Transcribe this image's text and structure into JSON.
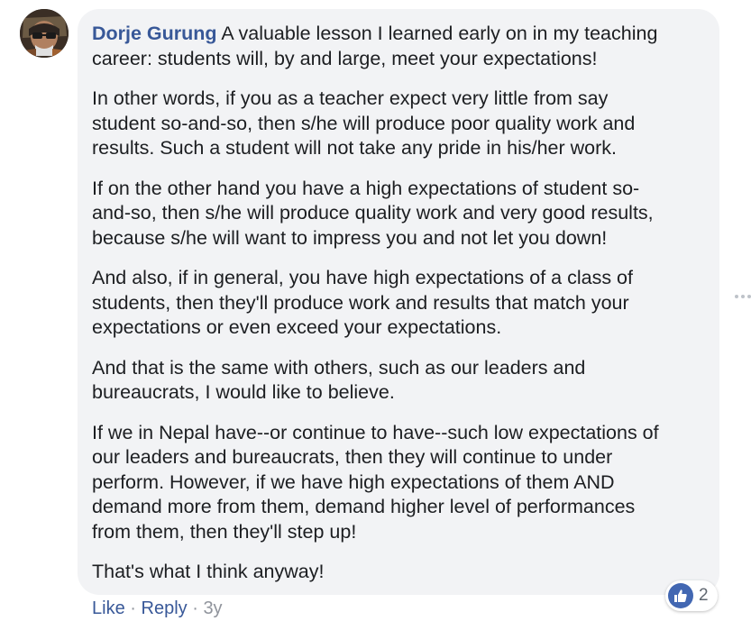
{
  "comment": {
    "author": "Dorje Gurung",
    "paragraphs": [
      "A valuable lesson I learned early on in my teaching\ncareer: students will, by and large, meet your expectations!",
      "In other words, if you as a teacher expect very little from say\nstudent so-and-so, then s/he will produce poor quality work and\nresults. Such a student will not take any pride in his/her work.",
      "If on the other hand you have a high expectations of student so-\nand-so, then s/he will produce quality work and very good results,\nbecause s/he will want to impress you and not let you down!",
      "And also, if in general, you have high expectations of a class of\nstudents, then they'll produce work and results that match your\nexpectations or even exceed your expectations.",
      "And that is the same with others, such as our leaders and\nbureaucrats, I would like to believe.",
      "If we in Nepal have--or continue to have--such low expectations of\nour leaders and bureaucrats, then they will continue to under\nperform. However, if we have high expectations of them AND\ndemand more from them, demand higher level of performances\nfrom them, then they'll step up!",
      "That's what I think anyway!"
    ]
  },
  "reactions": {
    "icon": "thumbs-up-icon",
    "count": "2",
    "color": "#4267b2"
  },
  "actions": {
    "like": "Like",
    "separator": "·",
    "reply": "Reply",
    "timestamp": "3y"
  },
  "colors": {
    "link": "#385898",
    "bubble": "#f2f3f5",
    "muted": "#90949c"
  }
}
